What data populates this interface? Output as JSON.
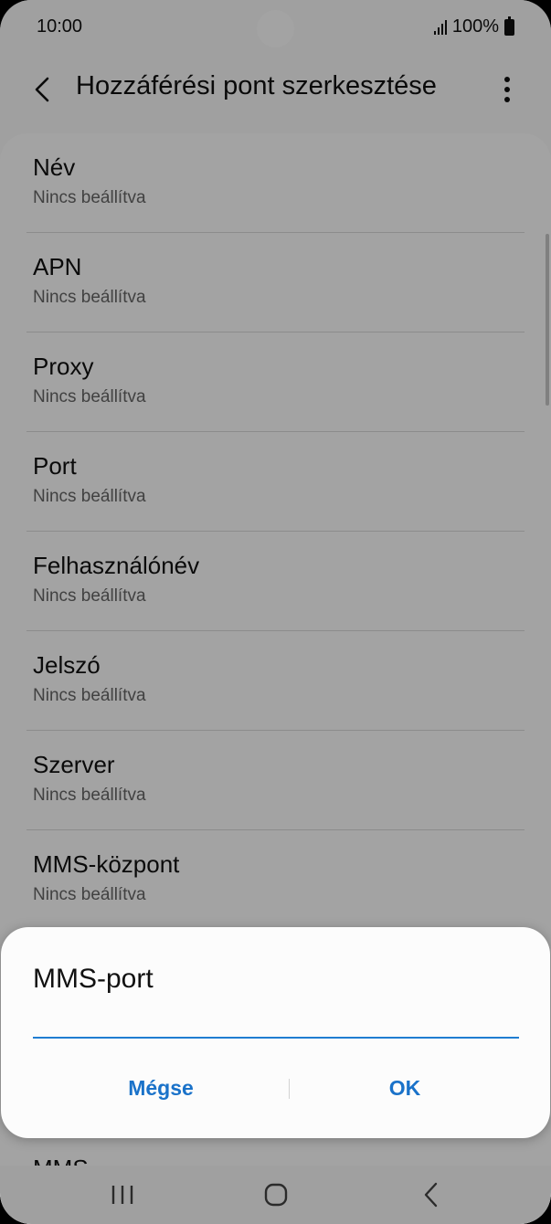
{
  "status_bar": {
    "time": "10:00",
    "battery": "100%",
    "icons": [
      "signal-icon",
      "battery-icon"
    ]
  },
  "app_bar": {
    "title": "Hozzáférési pont szerkesztése",
    "back_icon": "back-icon",
    "more_icon": "more-options-icon"
  },
  "settings": {
    "items": [
      {
        "title": "Név",
        "value": "Nincs beállítva"
      },
      {
        "title": "APN",
        "value": "Nincs beállítva"
      },
      {
        "title": "Proxy",
        "value": "Nincs beállítva"
      },
      {
        "title": "Port",
        "value": "Nincs beállítva"
      },
      {
        "title": "Felhasználónév",
        "value": "Nincs beállítva"
      },
      {
        "title": "Jelszó",
        "value": "Nincs beállítva"
      },
      {
        "title": "Szerver",
        "value": "Nincs beállítva"
      },
      {
        "title": "MMS-központ",
        "value": "Nincs beállítva"
      }
    ],
    "partial_item": "MMS"
  },
  "dialog": {
    "title": "MMS-port",
    "input_value": "",
    "cancel_label": "Mégse",
    "ok_label": "OK",
    "accent": "#1f7dd1"
  },
  "nav_bar": {
    "icons": [
      "recent-apps-icon",
      "home-icon",
      "back-nav-icon"
    ]
  }
}
